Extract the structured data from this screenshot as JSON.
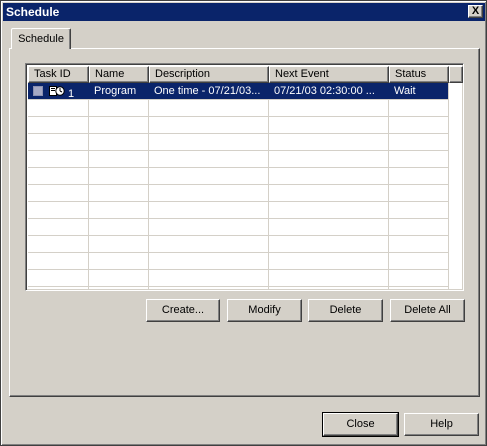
{
  "window": {
    "title": "Schedule",
    "close_glyph": "X"
  },
  "tabs": [
    {
      "label": "Schedule"
    }
  ],
  "table": {
    "columns": [
      "Task ID",
      "Name",
      "Description",
      "Next Event",
      "Status"
    ],
    "rows": [
      {
        "task_id": "1",
        "name": "Program",
        "description": "One time - 07/21/03...",
        "next_event": "07/21/03 02:30:00 ...",
        "status": "Wait",
        "selected": true
      }
    ],
    "selection_color": "#0a246a"
  },
  "actions": {
    "create": "Create...",
    "modify": "Modify",
    "delete": "Delete",
    "delete_all": "Delete All"
  },
  "footer": {
    "close": "Close",
    "help": "Help"
  },
  "colors": {
    "face": "#d4d0c8",
    "titlebar": "#0a246a"
  }
}
